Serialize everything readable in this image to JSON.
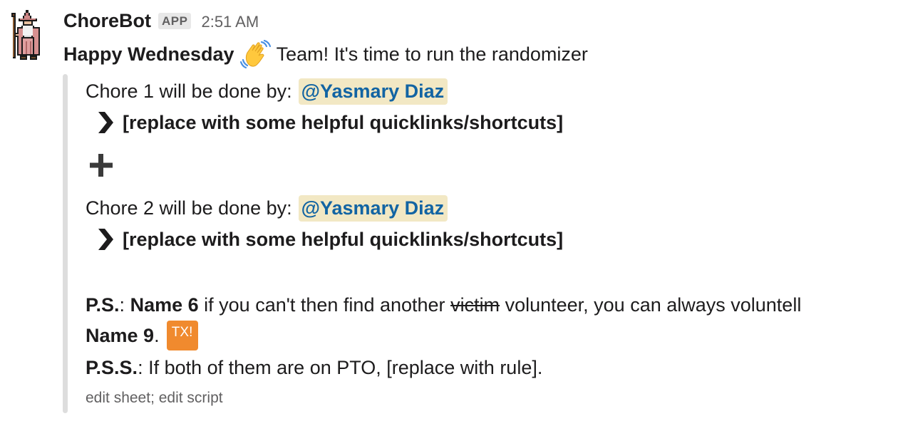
{
  "message": {
    "sender": "ChoreBot",
    "badge": "APP",
    "timestamp": "2:51 AM",
    "greeting_bold": "Happy Wednesday",
    "greeting_emoji": "wave-emoji",
    "greeting_rest": "Team! It's time to run the randomizer"
  },
  "attachment": {
    "bar_color": "#dddddd",
    "chores": [
      {
        "prefix": "Chore 1 will be done by:",
        "mention": "@Yasmary Diaz",
        "link_text": "[replace with some helpful quicklinks/shortcuts]"
      },
      {
        "prefix": "Chore 2 will be done by:",
        "mention": "@Yasmary Diaz",
        "link_text": "[replace with some helpful quicklinks/shortcuts]"
      }
    ],
    "separator_icon": "heavy-plus-icon",
    "ps": {
      "label": "P.S.",
      "colon": ":",
      "name_a": "Name 6",
      "text_1": "if you can't then find another",
      "struck": "victim",
      "text_2": "volunteer, you can always voluntell",
      "name_b": "Name 9",
      "period": ".",
      "emoji_text": "TX!"
    },
    "pss": {
      "label": "P.S.S.",
      "text": ": If both of them are on PTO, [replace with rule]."
    },
    "footer": "edit sheet; edit script"
  },
  "colors": {
    "mention_bg": "#f2e8c4",
    "mention_fg": "#1264a3",
    "emoji_bg": "#f08a2e"
  }
}
